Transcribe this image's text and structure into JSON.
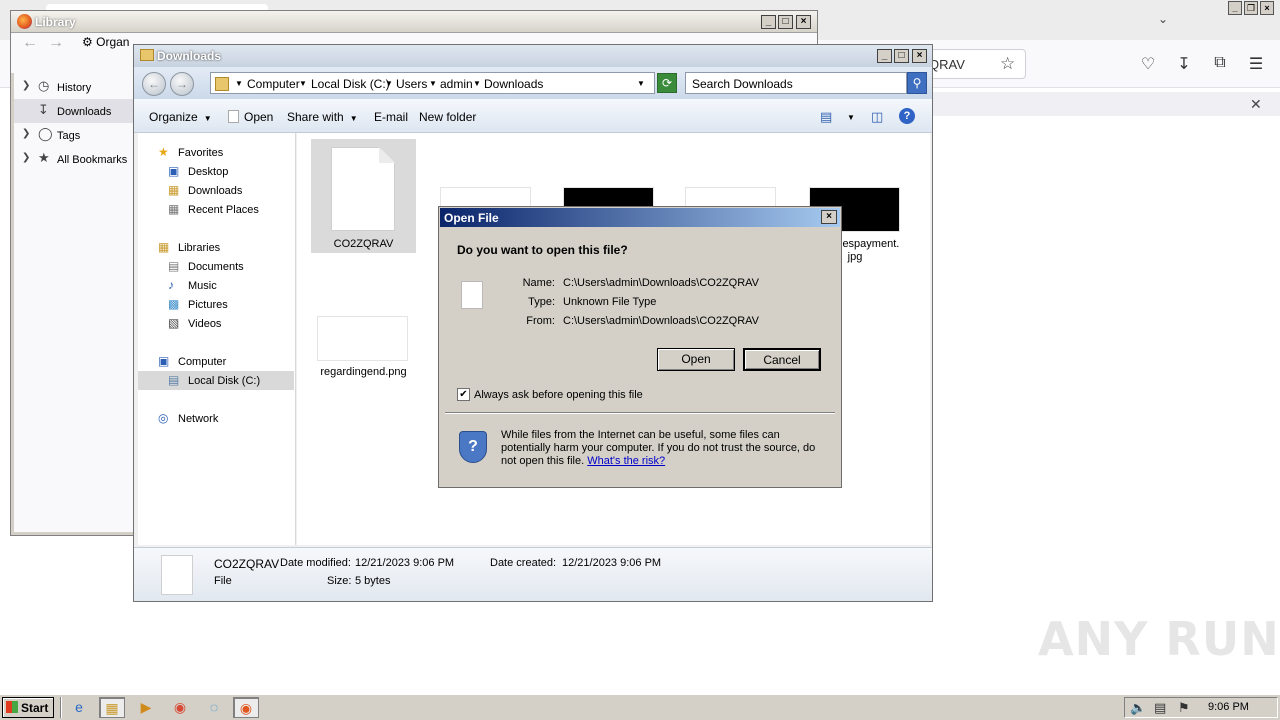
{
  "firefox": {
    "url_fragment": "QRAV"
  },
  "library": {
    "title": "Library",
    "organize_label": "Organ",
    "items": [
      {
        "label": "History"
      },
      {
        "label": "Downloads"
      },
      {
        "label": "Tags"
      },
      {
        "label": "All Bookmarks"
      }
    ]
  },
  "explorer": {
    "title": "Downloads",
    "breadcrumb": [
      "Computer",
      "Local Disk (C:)",
      "Users",
      "admin",
      "Downloads"
    ],
    "search_placeholder": "Search Downloads",
    "commands": {
      "organize": "Organize",
      "open": "Open",
      "share_with": "Share with",
      "email": "E-mail",
      "new_folder": "New folder"
    },
    "nav": {
      "favorites": "Favorites",
      "desktop": "Desktop",
      "downloads": "Downloads",
      "recent_places": "Recent Places",
      "libraries": "Libraries",
      "documents": "Documents",
      "music": "Music",
      "pictures": "Pictures",
      "videos": "Videos",
      "computer": "Computer",
      "local_disk": "Local Disk (C:)",
      "network": "Network"
    },
    "files": {
      "selected": "CO2ZQRAV",
      "payment_line1": "iespayment.",
      "payment_line2": "jpg",
      "regarding": "regardingend.png"
    },
    "details": {
      "name": "CO2ZQRAV",
      "modified_label": "Date modified:",
      "modified_value": "12/21/2023 9:06 PM",
      "created_label": "Date created:",
      "created_value": "12/21/2023 9:06 PM",
      "type": "File",
      "size_label": "Size:",
      "size_value": "5 bytes"
    }
  },
  "dialog": {
    "title": "Open File",
    "question": "Do you want to open this file?",
    "name_label": "Name:",
    "name_value": "C:\\Users\\admin\\Downloads\\CO2ZQRAV",
    "type_label": "Type:",
    "type_value": "Unknown File Type",
    "from_label": "From:",
    "from_value": "C:\\Users\\admin\\Downloads\\CO2ZQRAV",
    "open_button": "Open",
    "cancel_button": "Cancel",
    "checkbox_label": "Always ask before opening this file",
    "checkbox_checked": true,
    "warning_text": "While files from the Internet can be useful, some files can potentially harm your computer. If you do not trust the source, do not open this file.",
    "warning_link": "What's the risk?"
  },
  "watermark": "ANY RUN",
  "taskbar": {
    "start_label": "Start",
    "clock": "9:06 PM"
  }
}
